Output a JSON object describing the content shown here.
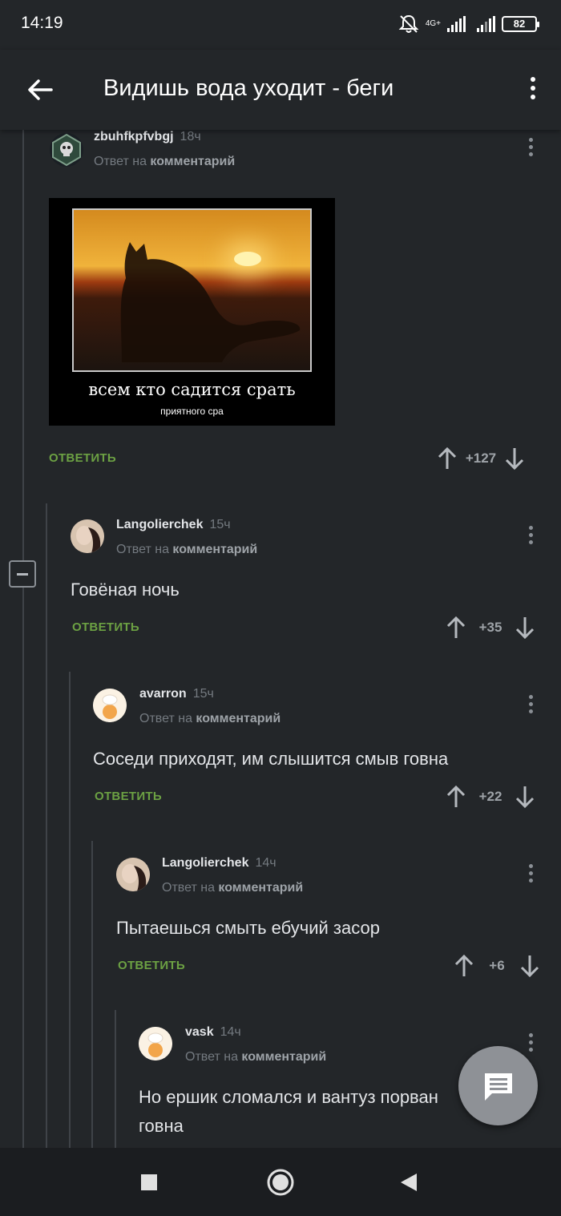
{
  "status_bar": {
    "time": "14:19",
    "network": "4G+",
    "battery": "82"
  },
  "app_bar": {
    "title": "Видишь вода уходит - беги"
  },
  "comments": [
    {
      "author": "zbuhfkpfvbgj",
      "ago": "18ч",
      "reply_prefix": "Ответ на",
      "reply_target": "комментарий",
      "image": {
        "caption": "всем кто садится срать",
        "subcaption": "приятного сра"
      },
      "reply_label": "ОТВЕТИТЬ",
      "score": "+127"
    },
    {
      "author": "Langolierchek",
      "ago": "15ч",
      "reply_prefix": "Ответ на",
      "reply_target": "комментарий",
      "text": "Говёная ночь",
      "reply_label": "ОТВЕТИТЬ",
      "score": "+35"
    },
    {
      "author": "avarron",
      "ago": "15ч",
      "reply_prefix": "Ответ на",
      "reply_target": "комментарий",
      "text": "Соседи приходят, им слышится смыв говна",
      "reply_label": "ОТВЕТИТЬ",
      "score": "+22"
    },
    {
      "author": "Langolierchek",
      "ago": "14ч",
      "reply_prefix": "Ответ на",
      "reply_target": "комментарий",
      "text": "Пытаешься смыть ебучий засор",
      "reply_label": "ОТВЕТИТЬ",
      "score": "+6"
    },
    {
      "author": "vask",
      "ago": "14ч",
      "reply_prefix": "Ответ на",
      "reply_target": "комментарий",
      "text_line1": "Но ершик сломался и вантуз порван",
      "text_line2": "говна"
    }
  ],
  "colors": {
    "background": "#232629",
    "reply_green": "#6ca143",
    "muted": "#747a80"
  }
}
